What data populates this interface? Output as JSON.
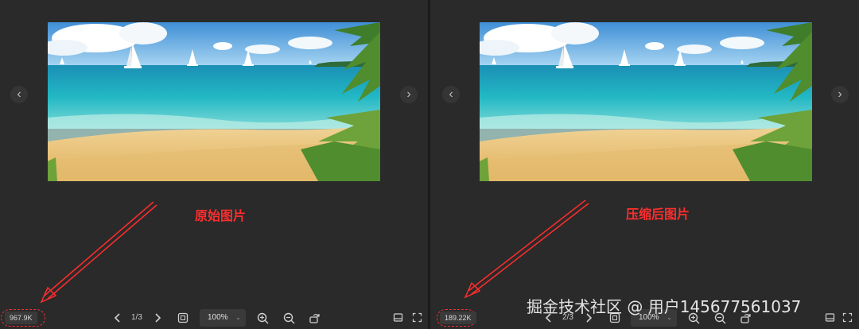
{
  "left_pane": {
    "annotation": "原始图片",
    "file_size": "967.9K",
    "page_indicator": "1/3",
    "zoom": "100%"
  },
  "right_pane": {
    "annotation": "压缩后图片",
    "file_size": "189.22K",
    "page_indicator": "2/3",
    "zoom": "100%"
  },
  "watermark": "掘金技术社区 @ 用户1456775610​37",
  "icons": {
    "prev": "chevron-left-icon",
    "next": "chevron-right-icon",
    "fit": "fit-to-window-icon",
    "zoom_in": "zoom-in-icon",
    "zoom_out": "zoom-out-icon",
    "rotate": "rotate-icon",
    "thumbnails": "thumbnail-strip-icon",
    "fullscreen": "fullscreen-icon"
  },
  "colors": {
    "annotation": "#ff2d2d",
    "background": "#2a2a2a"
  }
}
